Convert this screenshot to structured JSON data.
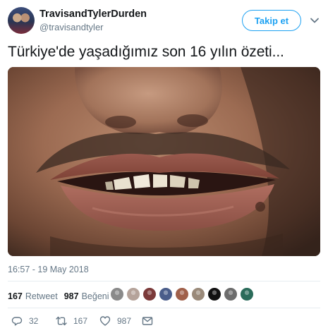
{
  "user": {
    "display_name": "TravisandTylerDurden",
    "handle": "@travisandtyler",
    "avatar_icon": "profile-photo"
  },
  "follow_button": {
    "label": "Takip et",
    "color": "#1da1f2"
  },
  "menu": {
    "icon": "chevron-down-icon"
  },
  "tweet": {
    "text": "Türkiye'de yaşadığımız son 16 yılın özeti...",
    "media_description_icon": "photo-closeup-mouth"
  },
  "timestamp": "16:57 - 19 May 2018",
  "stats": {
    "retweets_count": "167",
    "retweets_label": "Retweet",
    "likes_count": "987",
    "likes_label": "Beğeni"
  },
  "likers": [
    {
      "color": "#8a8a8a"
    },
    {
      "color": "#b5a39a"
    },
    {
      "color": "#7b3a3a"
    },
    {
      "color": "#4a5d8a"
    },
    {
      "color": "#a0604a"
    },
    {
      "color": "#9a8a7a"
    },
    {
      "color": "#111111"
    },
    {
      "color": "#6d6d6d"
    },
    {
      "color": "#2b6b5a"
    }
  ],
  "actions": {
    "reply": {
      "icon": "reply-icon",
      "count": "32"
    },
    "retweet": {
      "icon": "retweet-icon",
      "count": "167"
    },
    "like": {
      "icon": "heart-icon",
      "count": "987"
    },
    "message": {
      "icon": "envelope-icon"
    }
  },
  "colors": {
    "accent": "#1da1f2",
    "muted": "#657786",
    "text": "#14171a"
  }
}
